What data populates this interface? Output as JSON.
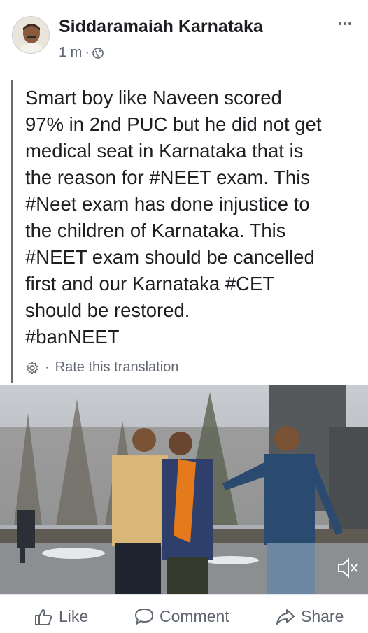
{
  "header": {
    "page_name": "Siddaramaiah Karnataka",
    "time": "1 m",
    "separator": "·",
    "privacy_icon": "globe-icon",
    "more_icon": "more-horizontal-icon"
  },
  "post": {
    "text": "Smart boy like Naveen scored\n97% in 2nd PUC but he did not get\nmedical seat in Karnataka that is\nthe reason for #NEET exam. This\n#Neet exam has done injustice to\nthe children of Karnataka. This\n#NEET exam should be cancelled\nfirst and our Karnataka #CET\nshould be restored.\n#banNEET",
    "translation_separator": "·",
    "translation_label": "Rate this translation",
    "translation_icon": "gear-icon"
  },
  "media": {
    "type": "video",
    "volume_icon": "volume-icon"
  },
  "actions": {
    "like_label": "Like",
    "comment_label": "Comment",
    "share_label": "Share"
  },
  "colors": {
    "text": "#1c1e21",
    "muted": "#606770",
    "quote_bar": "#6b6b6b"
  }
}
